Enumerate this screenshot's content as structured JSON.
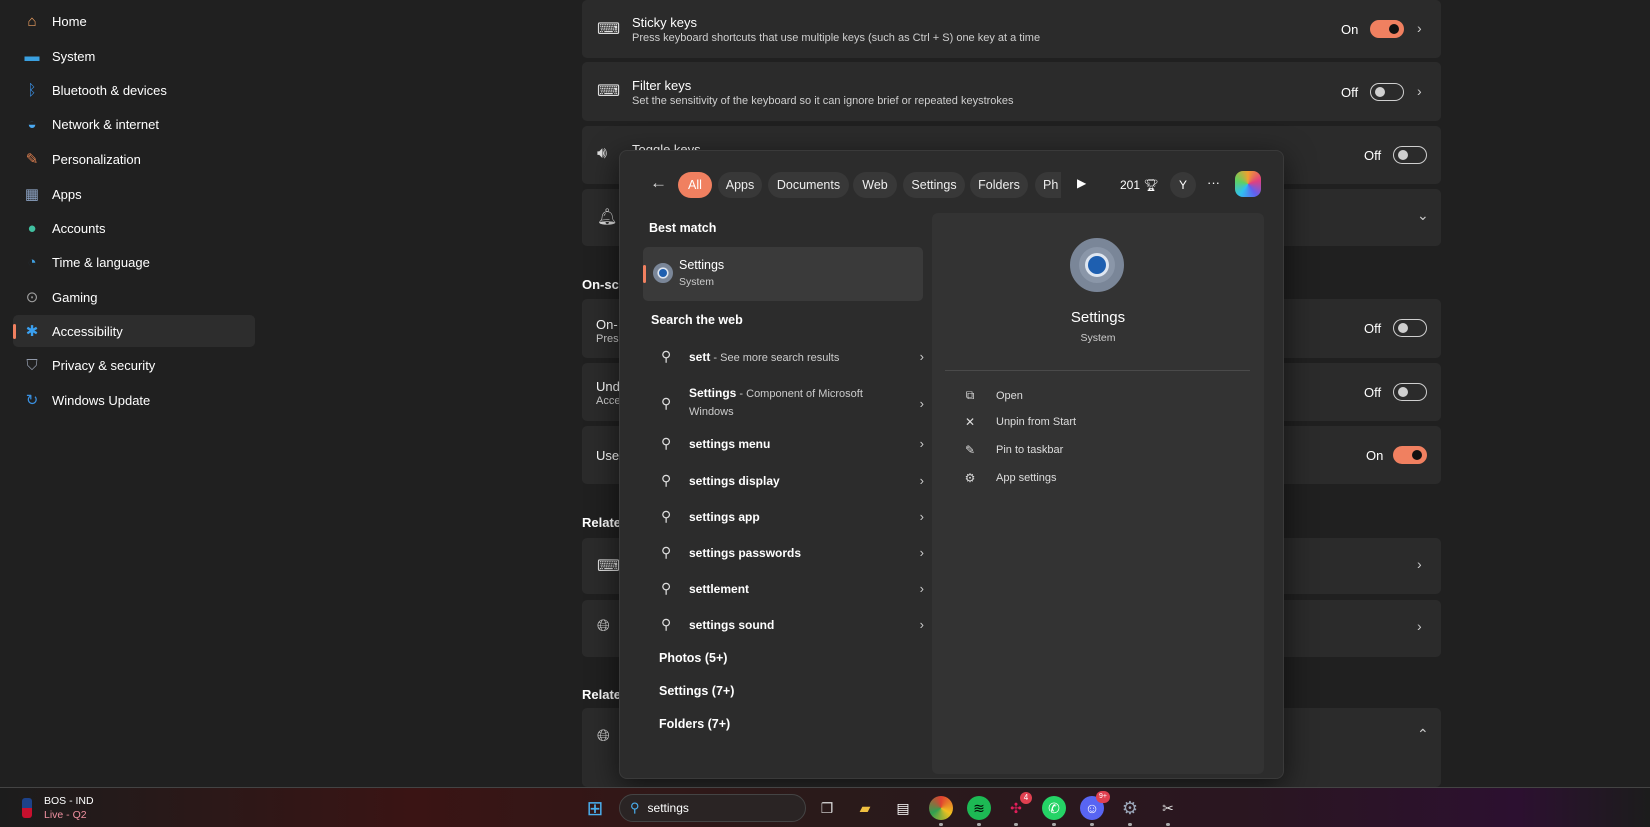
{
  "sidebar": {
    "items": [
      {
        "label": "Home",
        "icon": "home-icon",
        "color": "#f0a060"
      },
      {
        "label": "System",
        "icon": "monitor-icon",
        "color": "#3aa0e0"
      },
      {
        "label": "Bluetooth & devices",
        "icon": "bluetooth-icon",
        "color": "#3a8ee0"
      },
      {
        "label": "Network & internet",
        "icon": "wifi-icon",
        "color": "#4aa8f0"
      },
      {
        "label": "Personalization",
        "icon": "brush-icon",
        "color": "#e08050"
      },
      {
        "label": "Apps",
        "icon": "apps-icon",
        "color": "#8aa0c0"
      },
      {
        "label": "Accounts",
        "icon": "person-icon",
        "color": "#40c0a0"
      },
      {
        "label": "Time & language",
        "icon": "globe-clock-icon",
        "color": "#40a0e0"
      },
      {
        "label": "Gaming",
        "icon": "gamepad-icon",
        "color": "#a0a0a0"
      },
      {
        "label": "Accessibility",
        "icon": "accessibility-icon",
        "color": "#3aa0f0",
        "selected": true
      },
      {
        "label": "Privacy & security",
        "icon": "shield-icon",
        "color": "#9098a8"
      },
      {
        "label": "Windows Update",
        "icon": "update-icon",
        "color": "#3a90e0"
      }
    ]
  },
  "main": {
    "sticky": {
      "title": "Sticky keys",
      "desc": "Press keyboard shortcuts that use multiple keys (such as Ctrl + S) one key at a time",
      "state": "On"
    },
    "filter": {
      "title": "Filter keys",
      "desc": "Set the sensitivity of the keyboard so it can ignore brief or repeated keystrokes",
      "state": "Off"
    },
    "toggle": {
      "title": "Toggle keys",
      "state": "Off"
    },
    "onscreen_heading": "On-scr",
    "onscreen": {
      "title": "On-",
      "desc": "Press",
      "state": "Off"
    },
    "underline": {
      "title": "Und",
      "desc": "Acce",
      "state": "Off"
    },
    "use": {
      "title": "Use",
      "state": "On"
    },
    "related1": "Relate",
    "related2": "Relate"
  },
  "search": {
    "filters": [
      "All",
      "Apps",
      "Documents",
      "Web",
      "Settings",
      "Folders",
      "Ph"
    ],
    "points": "201",
    "avatar": "Y",
    "more": "···",
    "best_match_label": "Best match",
    "best": {
      "title": "Settings",
      "sub": "System"
    },
    "web_label": "Search the web",
    "web": [
      {
        "bold": "sett",
        "rest": " - See more search results"
      },
      {
        "bold": "Settings",
        "rest": " - Component of Microsoft",
        "line2": "Windows"
      },
      {
        "bold": "settings menu",
        "rest": ""
      },
      {
        "bold": "settings display",
        "rest": ""
      },
      {
        "bold": "settings app",
        "rest": ""
      },
      {
        "bold": "settings passwords",
        "rest": ""
      },
      {
        "bold": "settlement",
        "rest": ""
      },
      {
        "bold": "settings sound",
        "rest": ""
      }
    ],
    "groups": [
      "Photos (5+)",
      "Settings (7+)",
      "Folders (7+)"
    ],
    "detail": {
      "title": "Settings",
      "sub": "System",
      "actions": [
        "Open",
        "Unpin from Start",
        "Pin to taskbar",
        "App settings"
      ]
    }
  },
  "taskbar": {
    "score": "BOS - IND",
    "status": "Live - Q2",
    "search_value": "settings",
    "badges": {
      "slack": "4",
      "discord": "9+"
    }
  }
}
